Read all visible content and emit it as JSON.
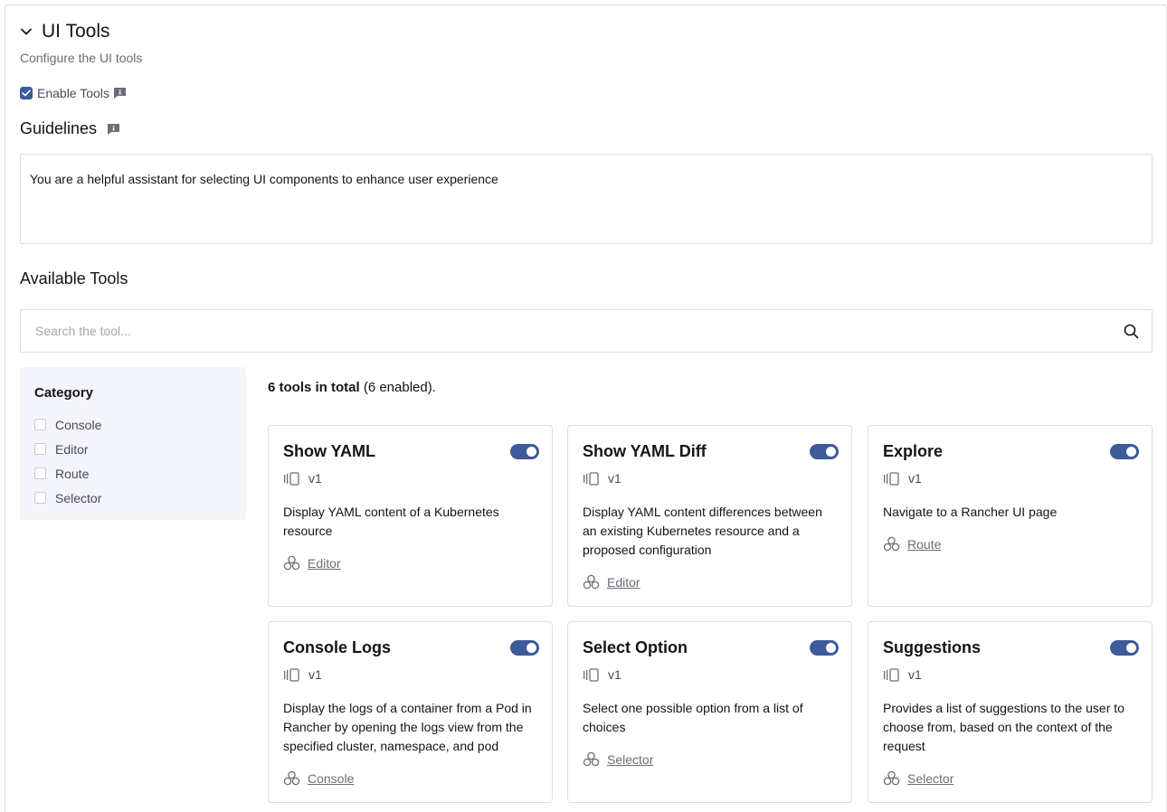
{
  "section": {
    "title": "UI Tools",
    "description": "Configure the UI tools"
  },
  "enable_tools": {
    "label": "Enable Tools",
    "checked": true
  },
  "guidelines": {
    "title": "Guidelines",
    "value": "You are a helpful assistant for selecting UI components to enhance user experience"
  },
  "available_tools": {
    "title": "Available Tools",
    "search_placeholder": "Search the tool...",
    "total_bold": "6 tools in total",
    "total_rest": " (6 enabled)."
  },
  "category": {
    "title": "Category",
    "items": [
      {
        "label": "Console",
        "checked": false
      },
      {
        "label": "Editor",
        "checked": false
      },
      {
        "label": "Route",
        "checked": false
      },
      {
        "label": "Selector",
        "checked": false
      }
    ]
  },
  "tools": [
    {
      "name": "Show YAML",
      "version": "v1",
      "enabled": true,
      "description": "Display YAML content of a Kubernetes resource",
      "category": "Editor"
    },
    {
      "name": "Show YAML Diff",
      "version": "v1",
      "enabled": true,
      "description": "Display YAML content differences between an existing Kubernetes resource and a proposed configuration",
      "category": "Editor"
    },
    {
      "name": "Explore",
      "version": "v1",
      "enabled": true,
      "description": "Navigate to a Rancher UI page",
      "category": "Route"
    },
    {
      "name": "Console Logs",
      "version": "v1",
      "enabled": true,
      "description": "Display the logs of a container from a Pod in Rancher by opening the logs view from the specified cluster, namespace, and pod",
      "category": "Console"
    },
    {
      "name": "Select Option",
      "version": "v1",
      "enabled": true,
      "description": "Select one possible option from a list of choices",
      "category": "Selector"
    },
    {
      "name": "Suggestions",
      "version": "v1",
      "enabled": true,
      "description": "Provides a list of suggestions to the user to choose from, based on the context of the request",
      "category": "Selector"
    }
  ],
  "colors": {
    "accent": "#3d5a99",
    "border": "#dcdee7",
    "panel_bg": "#f4f5fa"
  },
  "icons": {
    "collapse": "chevron-down-icon",
    "info": "info-icon",
    "search": "search-icon",
    "version": "version-icon",
    "category": "category-icon"
  }
}
